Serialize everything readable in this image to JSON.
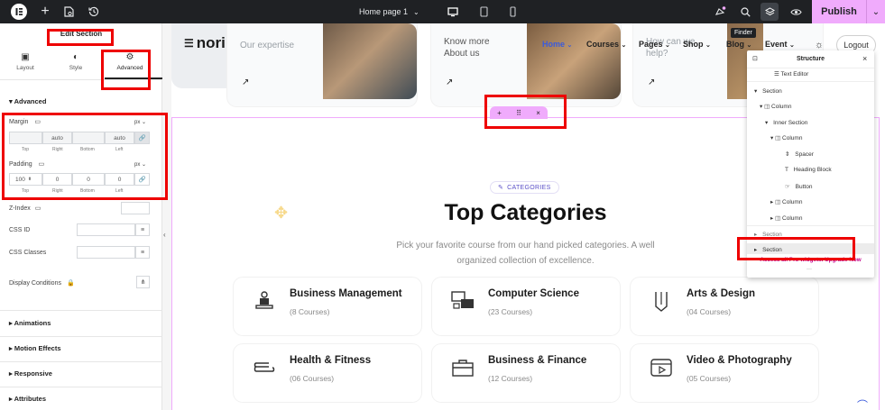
{
  "topbar": {
    "page_title": "Home page 1",
    "publish": "Publish",
    "finder_tooltip": "Finder"
  },
  "panel": {
    "title": "Edit Section",
    "tabs": [
      "Layout",
      "Style",
      "Advanced"
    ],
    "advanced_heading": "Advanced",
    "margin_label": "Margin",
    "margin_unit": "px",
    "margin_values": [
      "",
      "auto",
      "",
      "auto"
    ],
    "padding_label": "Padding",
    "padding_unit": "px",
    "padding_values": [
      "100",
      "0",
      "0",
      "0"
    ],
    "side_labels": [
      "Top",
      "Right",
      "Bottom",
      "Left"
    ],
    "zindex_label": "Z-Index",
    "cssid_label": "CSS ID",
    "cssclasses_label": "CSS Classes",
    "display_conditions_label": "Display Conditions",
    "sections": [
      "Animations",
      "Motion Effects",
      "Responsive",
      "Attributes"
    ]
  },
  "site": {
    "logo": "nori",
    "nav": [
      "Home",
      "Courses",
      "Pages",
      "Shop",
      "Blog",
      "Event"
    ],
    "logout": "Logout",
    "hero_cards": [
      "Our expertise",
      "Know more\nAbout us",
      "How can we\nhelp?"
    ],
    "badge": "CATEGORIES",
    "heading": "Top Categories",
    "subtitle_line1": "Pick your favorite course from our hand picked categories. A well",
    "subtitle_line2": "organized collection of excellence.",
    "categories": [
      {
        "title": "Business Management",
        "count": "(8 Courses)"
      },
      {
        "title": "Computer Science",
        "count": "(23 Courses)"
      },
      {
        "title": "Arts & Design",
        "count": "(04 Courses)"
      },
      {
        "title": "Health & Fitness",
        "count": "(06 Courses)"
      },
      {
        "title": "Business & Finance",
        "count": "(12 Courses)"
      },
      {
        "title": "Video & Photography",
        "count": "(05 Courses)"
      }
    ]
  },
  "structure": {
    "title": "Structure",
    "items": [
      "Text Editor",
      "Section",
      "Column",
      "Inner Section",
      "Column",
      "Spacer",
      "Heading Block",
      "Button",
      "Column",
      "Column",
      "Section",
      "Section"
    ],
    "promo": "Access all Pro widgets. Upgrade Now"
  },
  "colors": {
    "accent": "#f0abfc",
    "brand_magenta": "#d004d4",
    "nav_active": "#3b5bdb",
    "annotation_red": "#ee0000"
  }
}
